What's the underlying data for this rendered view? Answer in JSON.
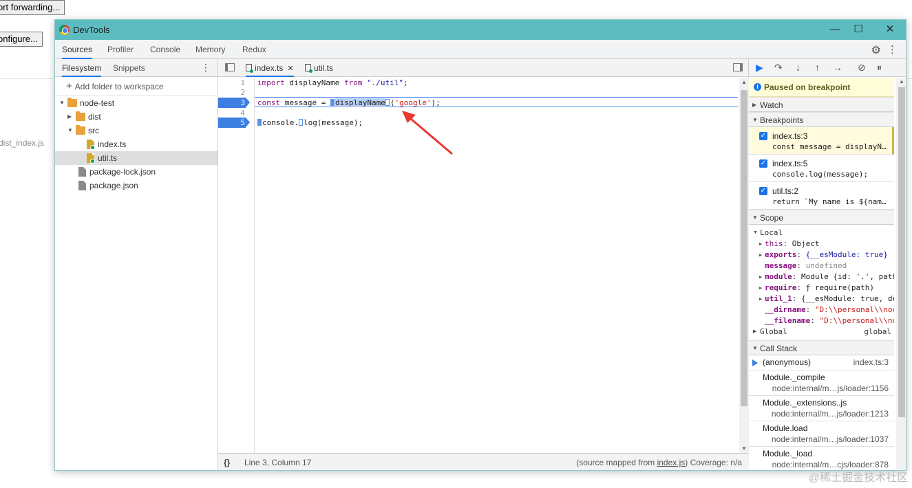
{
  "background": {
    "port_forwarding_button": "ort forwarding...",
    "configure_button": "onfigure...",
    "file_label": "dist_index.js"
  },
  "window": {
    "title": "DevTools",
    "minimize": "—",
    "maximize": "☐",
    "close": "✕"
  },
  "tabs": [
    "Sources",
    "Profiler",
    "Console",
    "Memory",
    "Redux"
  ],
  "navigator": {
    "tabs": [
      "Filesystem",
      "Snippets"
    ],
    "add_folder": "Add folder to workspace",
    "tree": [
      {
        "label": "node-test",
        "type": "folder",
        "depth": 0,
        "expanded": true
      },
      {
        "label": "dist",
        "type": "folder",
        "depth": 1,
        "expanded": false
      },
      {
        "label": "src",
        "type": "folder",
        "depth": 1,
        "expanded": true
      },
      {
        "label": "index.ts",
        "type": "ts",
        "depth": 2
      },
      {
        "label": "util.ts",
        "type": "ts",
        "depth": 2,
        "selected": true
      },
      {
        "label": "package-lock.json",
        "type": "file",
        "depth": 1
      },
      {
        "label": "package.json",
        "type": "file",
        "depth": 1
      }
    ]
  },
  "editor": {
    "tabs": [
      {
        "label": "index.ts",
        "closable": true,
        "active": true
      },
      {
        "label": "util.ts",
        "closable": false,
        "active": false
      }
    ],
    "close_glyph": "✕",
    "lines": [
      {
        "n": "1",
        "bp": false
      },
      {
        "n": "2",
        "bp": false
      },
      {
        "n": "3",
        "bp": true
      },
      {
        "n": "4",
        "bp": false
      },
      {
        "n": "5",
        "bp": true
      }
    ],
    "code": {
      "l1_kw1": "import",
      "l1_id": " displayName ",
      "l1_kw2": "from",
      "l1_str": " \"./util\"",
      "l1_end": ";",
      "l3_kw": "const",
      "l3_mid": " message = ",
      "l3_hl": "displayName",
      "l3_open": "(",
      "l3_str": "'google'",
      "l3_end": ");",
      "l5_a": "console.",
      "l5_b": "log",
      "l5_c": "(message);"
    },
    "status": {
      "braces": "{}",
      "position": "Line 3, Column 17",
      "mapped_prefix": "(source mapped from ",
      "mapped_link": "index.js",
      "mapped_suffix": ") Coverage: n/a"
    }
  },
  "debugger": {
    "paused": "Paused on breakpoint",
    "sections": {
      "watch": "Watch",
      "breakpoints": "Breakpoints",
      "scope": "Scope",
      "callstack": "Call Stack"
    },
    "breakpoints": [
      {
        "loc": "index.ts:3",
        "code": "const message = displayN…",
        "active": true
      },
      {
        "loc": "index.ts:5",
        "code": "console.log(message);",
        "active": false
      },
      {
        "loc": "util.ts:2",
        "code": "return `My name is ${nam…",
        "active": false
      }
    ],
    "scope": {
      "local": "Local",
      "global": "Global",
      "global_value": "global",
      "rows": [
        {
          "k": "this",
          "v": "Object",
          "expandable": true,
          "bold": false,
          "vclass": ""
        },
        {
          "k": "exports",
          "v": "{__esModule: true}",
          "expandable": true,
          "bold": true,
          "vclass": "b"
        },
        {
          "k": "message",
          "v": "undefined",
          "expandable": false,
          "bold": true,
          "vclass": "u"
        },
        {
          "k": "module",
          "v": "Module {id: '.', path",
          "expandable": true,
          "bold": true,
          "vclass": ""
        },
        {
          "k": "require",
          "v": "ƒ require(path)",
          "expandable": true,
          "bold": true,
          "vclass": ""
        },
        {
          "k": "util_1",
          "v": "{__esModule: true, de",
          "expandable": true,
          "bold": true,
          "vclass": ""
        },
        {
          "k": "__dirname",
          "v": "\"D:\\\\personal\\\\noc",
          "expandable": false,
          "bold": true,
          "vclass": "s"
        },
        {
          "k": "__filename",
          "v": "\"D:\\\\personal\\\\noc",
          "expandable": false,
          "bold": true,
          "vclass": "s"
        }
      ]
    },
    "callstack": [
      {
        "fn": "(anonymous)",
        "loc": "index.ts:3",
        "current": true
      },
      {
        "fn": "Module._compile",
        "loc": "node:internal/m…js/loader:1156",
        "current": false
      },
      {
        "fn": "Module._extensions..js",
        "loc": "node:internal/m…js/loader:1213",
        "current": false
      },
      {
        "fn": "Module.load",
        "loc": "node:internal/m…js/loader:1037",
        "current": false
      },
      {
        "fn": "Module._load",
        "loc": "node:internal/m…cjs/loader:878",
        "current": false
      }
    ]
  },
  "watermark": "@稀土掘金技术社区",
  "colors": {
    "titlebar": "#5dbcc0",
    "accent": "#1a73e8",
    "breakpoint": "#3c7fe0",
    "arrow": "#e8382f"
  }
}
